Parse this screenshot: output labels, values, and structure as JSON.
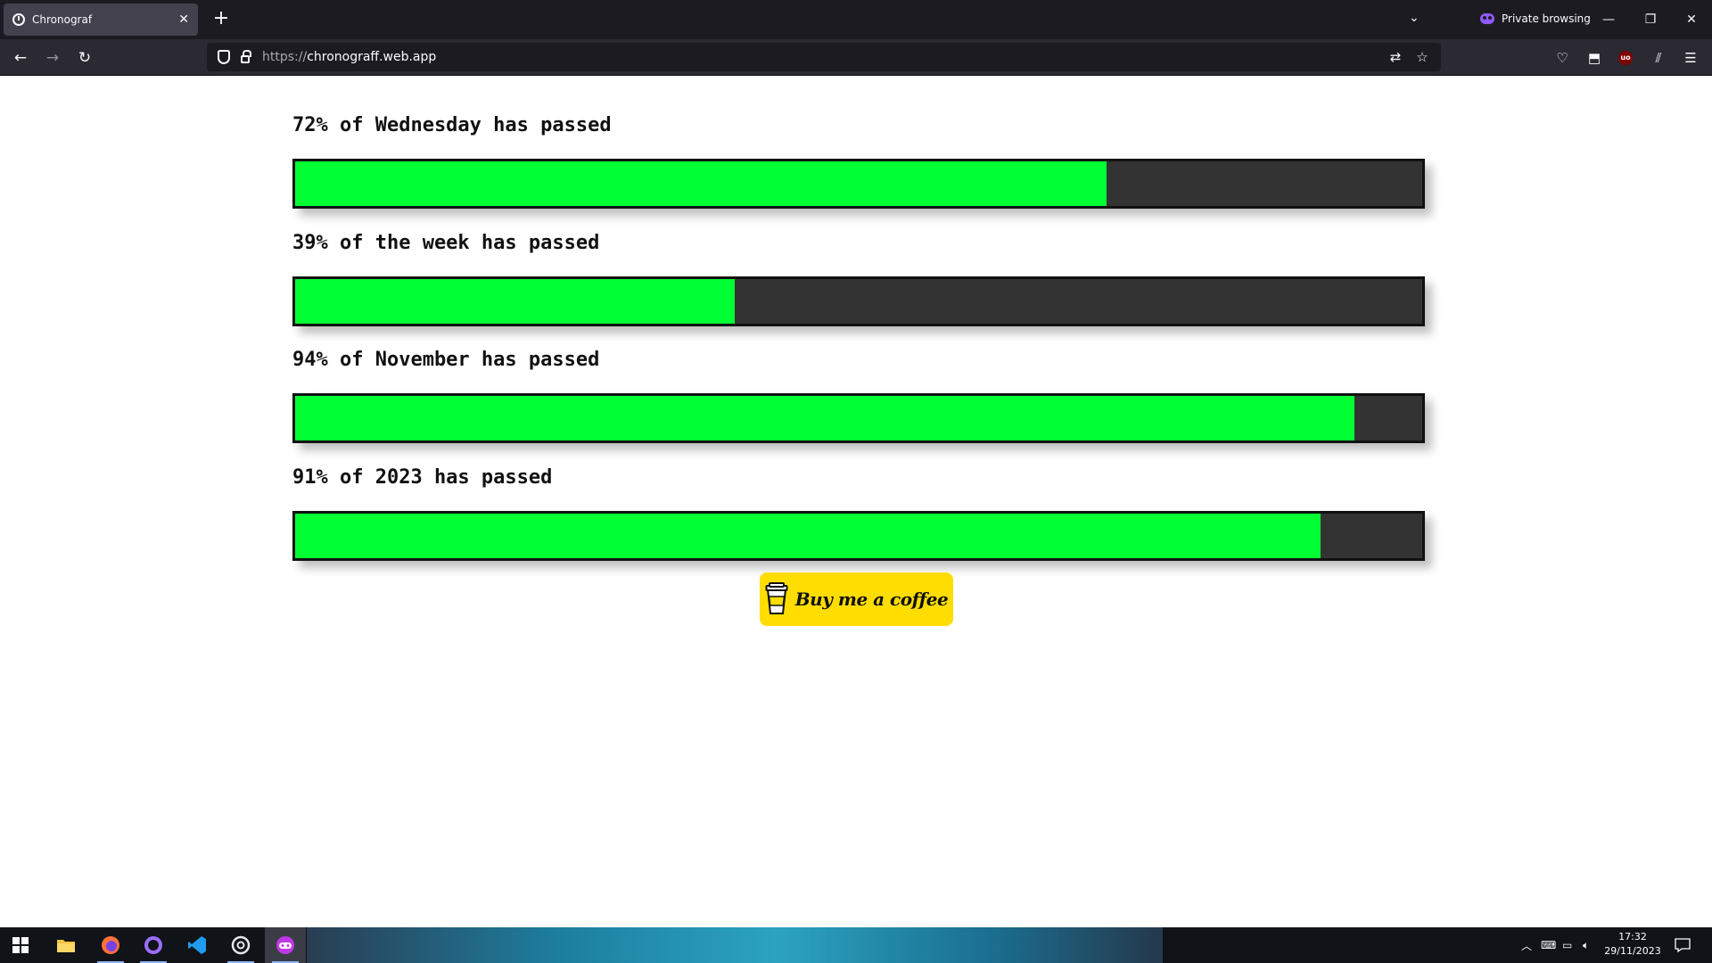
{
  "browser": {
    "tab_title": "Chronograf",
    "tab_close": "✕",
    "new_tab": "+",
    "tab_list": "⌄",
    "private_label": "Private browsing",
    "url_scheme": "https://",
    "url_host": "chronograff.web.app",
    "minimize": "—",
    "restore": "❐",
    "close": "✕"
  },
  "progress": [
    {
      "label": "72% of Wednesday has passed",
      "percent": 72
    },
    {
      "label": "39% of the week has passed",
      "percent": 39
    },
    {
      "label": "94% of November has passed",
      "percent": 94
    },
    {
      "label": "91% of 2023 has passed",
      "percent": 91
    }
  ],
  "coffee_button": {
    "label": "Buy me a coffee",
    "color": "#ffdd00"
  },
  "colors": {
    "fill": "#00ff33",
    "track": "#333333"
  },
  "taskbar": {
    "time": "17:32",
    "date": "29/11/2023",
    "apps": [
      "windows-start",
      "file-explorer",
      "firefox",
      "github-desktop",
      "vscode",
      "chatgpt",
      "firefox-private"
    ]
  }
}
